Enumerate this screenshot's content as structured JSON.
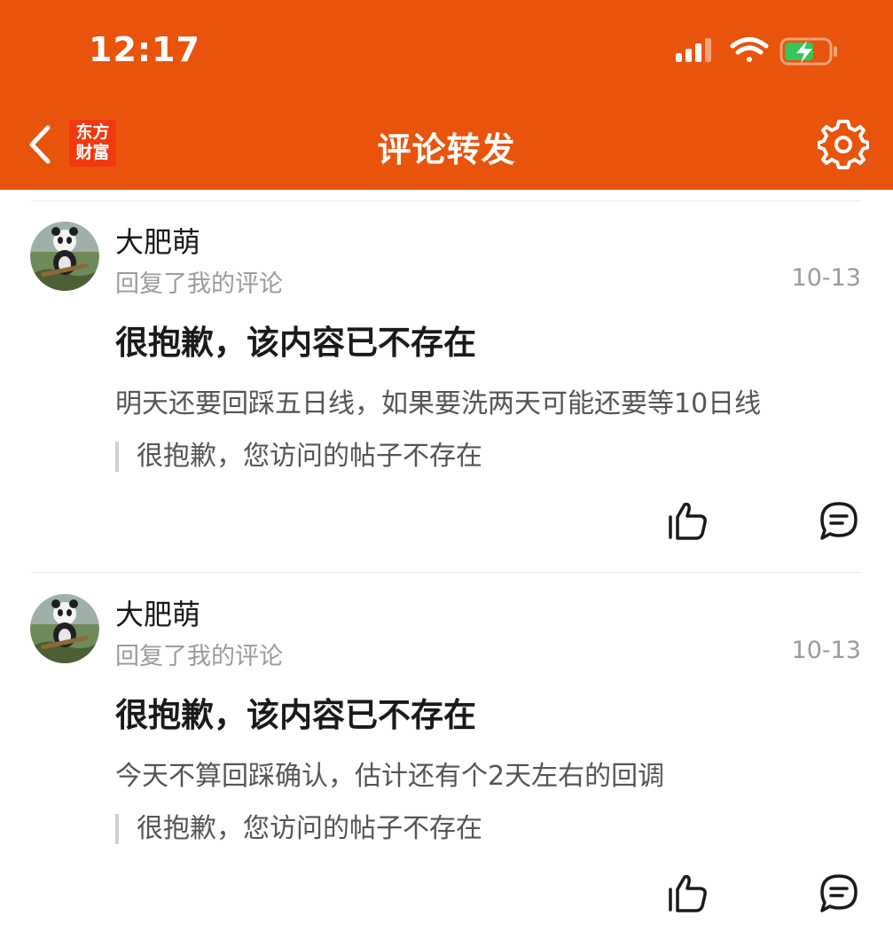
{
  "status_bar": {
    "time": "12:17"
  },
  "nav": {
    "logo_line1": "东方",
    "logo_line2": "财富",
    "title": "评论转发"
  },
  "colors": {
    "brand": "#E8540C",
    "logo": "#F2380E",
    "battery": "#34C759"
  },
  "comments": [
    {
      "username": "大肥萌",
      "action": "回复了我的评论",
      "date": "10-13",
      "title": "很抱歉，该内容已不存在",
      "text": "明天还要回踩五日线，如果要洗两天可能还要等10日线",
      "quote": "很抱歉，您访问的帖子不存在"
    },
    {
      "username": "大肥萌",
      "action": "回复了我的评论",
      "date": "10-13",
      "title": "很抱歉，该内容已不存在",
      "text": "今天不算回踩确认，估计还有个2天左右的回调",
      "quote": "很抱歉，您访问的帖子不存在"
    }
  ],
  "icons": {
    "back": "chevron-left-icon",
    "settings": "gear-icon",
    "like": "thumbs-up-icon",
    "reply": "comment-bubble-icon"
  }
}
